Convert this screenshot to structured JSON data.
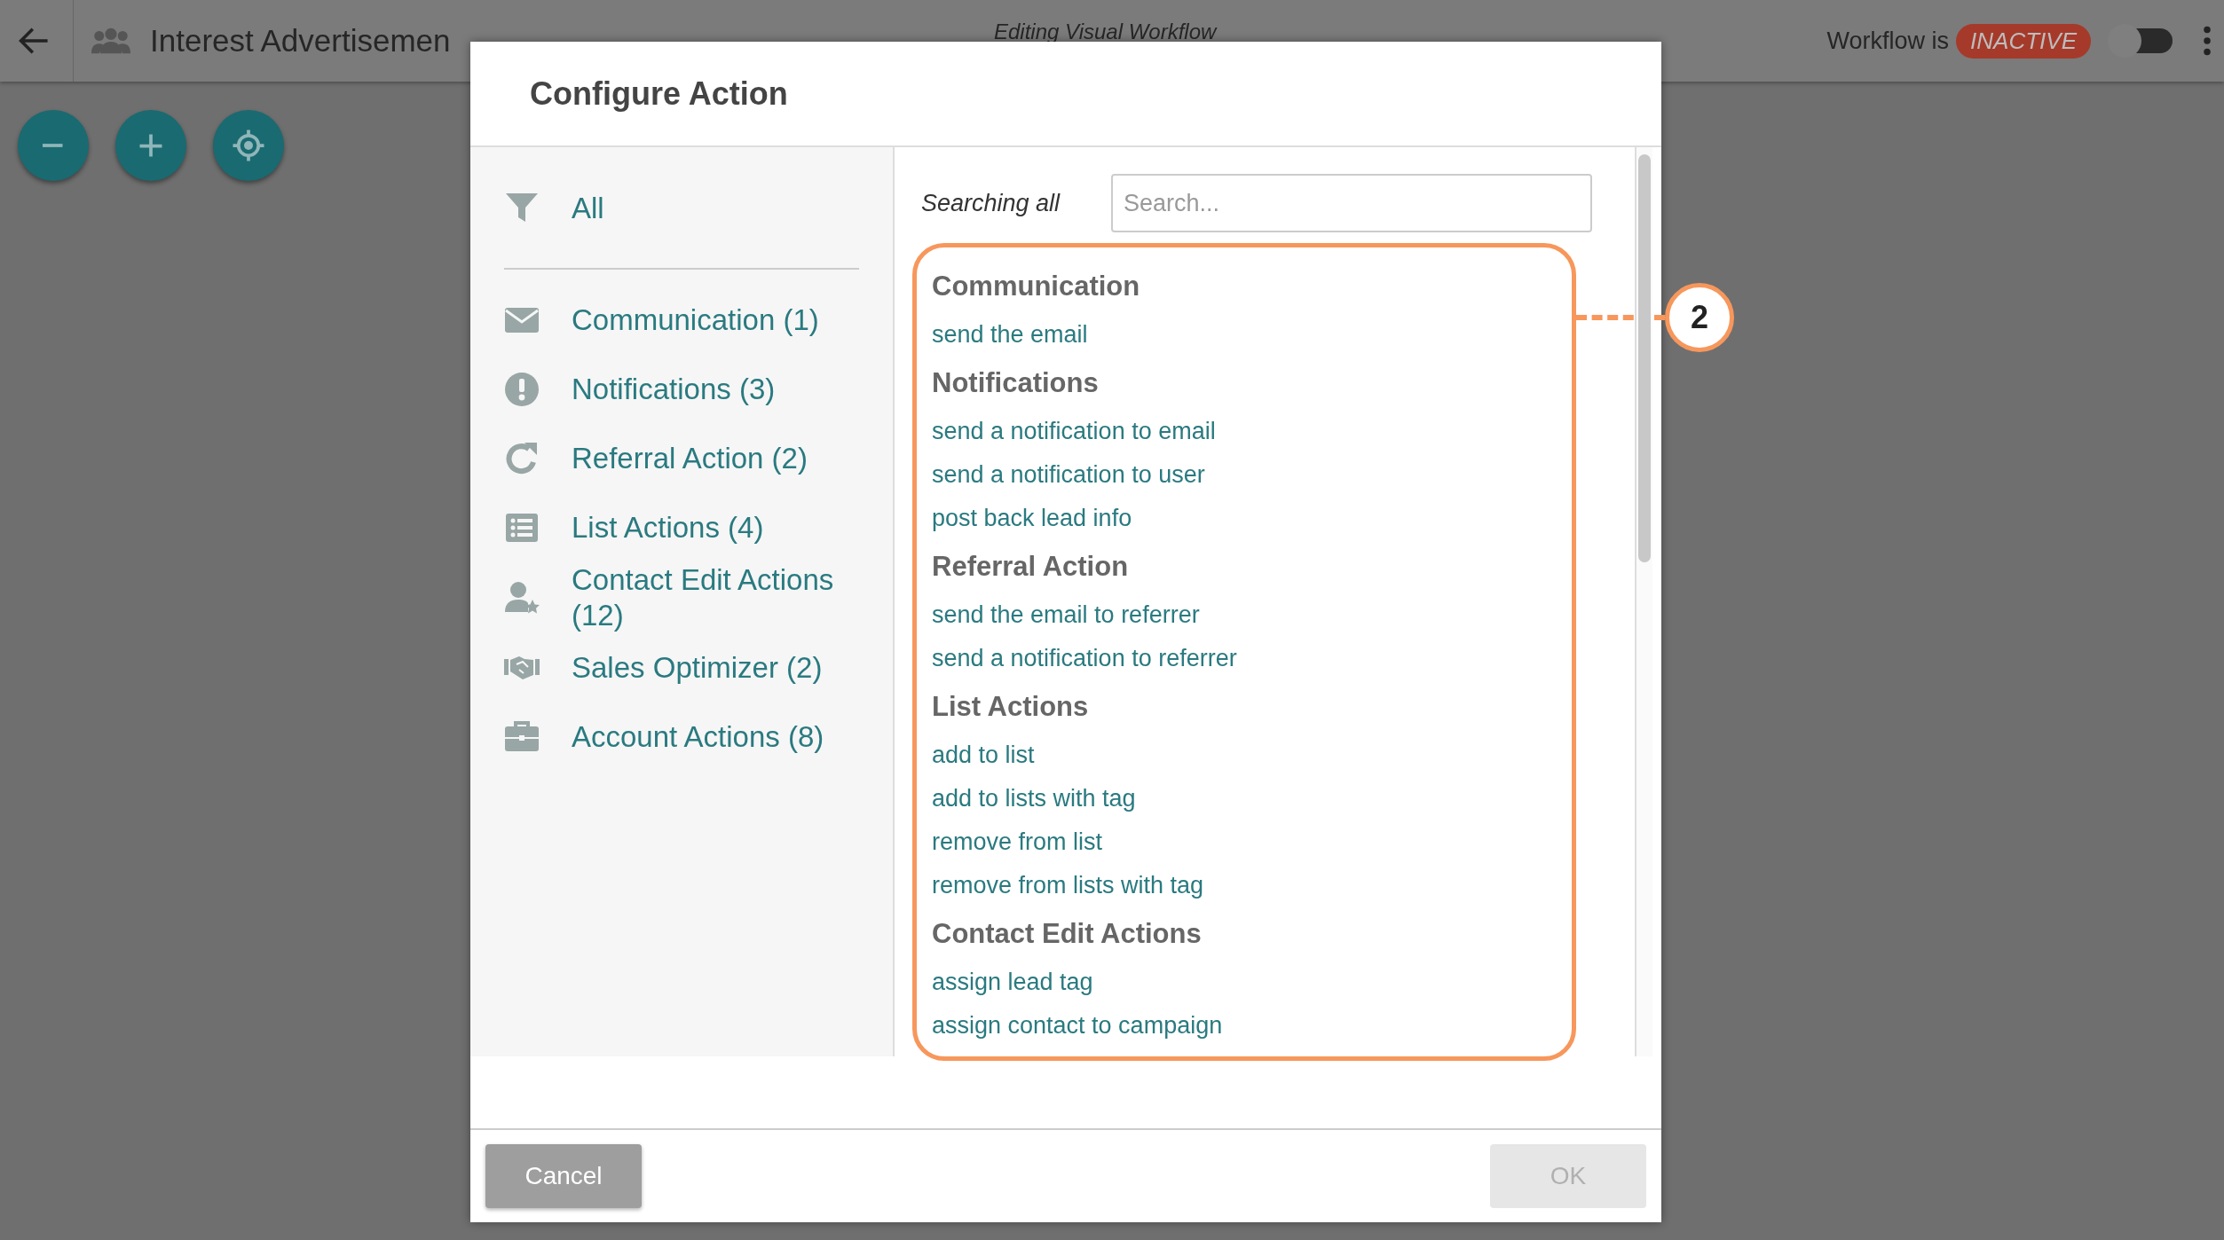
{
  "app_bar": {
    "title": "Interest Advertisemen",
    "subtitle": "Editing Visual Workflow",
    "status_label": "Workflow is",
    "status": "INACTIVE",
    "toggle_on": false
  },
  "dialog": {
    "title": "Configure Action",
    "filters": [
      {
        "label": "All",
        "kind": "filter"
      },
      {
        "label": "Communication (1)",
        "kind": "mail"
      },
      {
        "label": "Notifications (3)",
        "kind": "alert"
      },
      {
        "label": "Referral Action (2)",
        "kind": "redo"
      },
      {
        "label": "List Actions (4)",
        "kind": "list"
      },
      {
        "label": "Contact Edit Actions (12)",
        "kind": "person"
      },
      {
        "label": "Sales Optimizer (2)",
        "kind": "handshake"
      },
      {
        "label": "Account Actions (8)",
        "kind": "briefcase"
      }
    ],
    "search": {
      "label": "Searching all",
      "placeholder": "Search..."
    },
    "groups": [
      {
        "heading": "Communication",
        "actions": [
          "send the email"
        ]
      },
      {
        "heading": "Notifications",
        "actions": [
          "send a notification to email",
          "send a notification to user",
          "post back lead info"
        ]
      },
      {
        "heading": "Referral Action",
        "actions": [
          "send the email to referrer",
          "send a notification to referrer"
        ]
      },
      {
        "heading": "List Actions",
        "actions": [
          "add to list",
          "add to lists with tag",
          "remove from list",
          "remove from lists with tag"
        ]
      },
      {
        "heading": "Contact Edit Actions",
        "actions": [
          "assign lead tag",
          "assign contact to campaign"
        ]
      }
    ],
    "callout": {
      "label": "2"
    },
    "buttons": [
      {
        "label": "Cancel",
        "disabled": false
      },
      {
        "label": "OK",
        "disabled": true
      }
    ]
  }
}
